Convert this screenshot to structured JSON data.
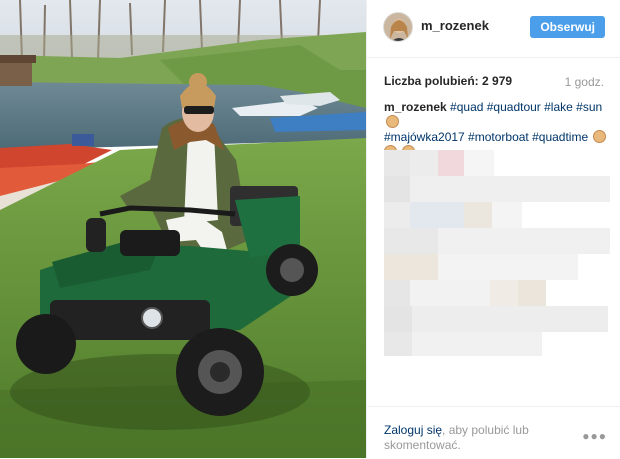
{
  "post": {
    "username": "m_rozenek",
    "follow_label": "Obserwuj",
    "likes_label": "Liczba polubień:",
    "likes_count": "2 979",
    "time": "1 godz.",
    "caption_user": "m_rozenek",
    "caption_line1": "#quad #quadtour #lake #sun",
    "caption_line2": "#majówka2017 #motorboat #quadtime",
    "emoji_name": "flexed-biceps-icon"
  },
  "footer": {
    "login_link": "Zaloguj się",
    "login_text": ", aby polubić lub skomentować.",
    "more_icon": "more-options-icon"
  }
}
